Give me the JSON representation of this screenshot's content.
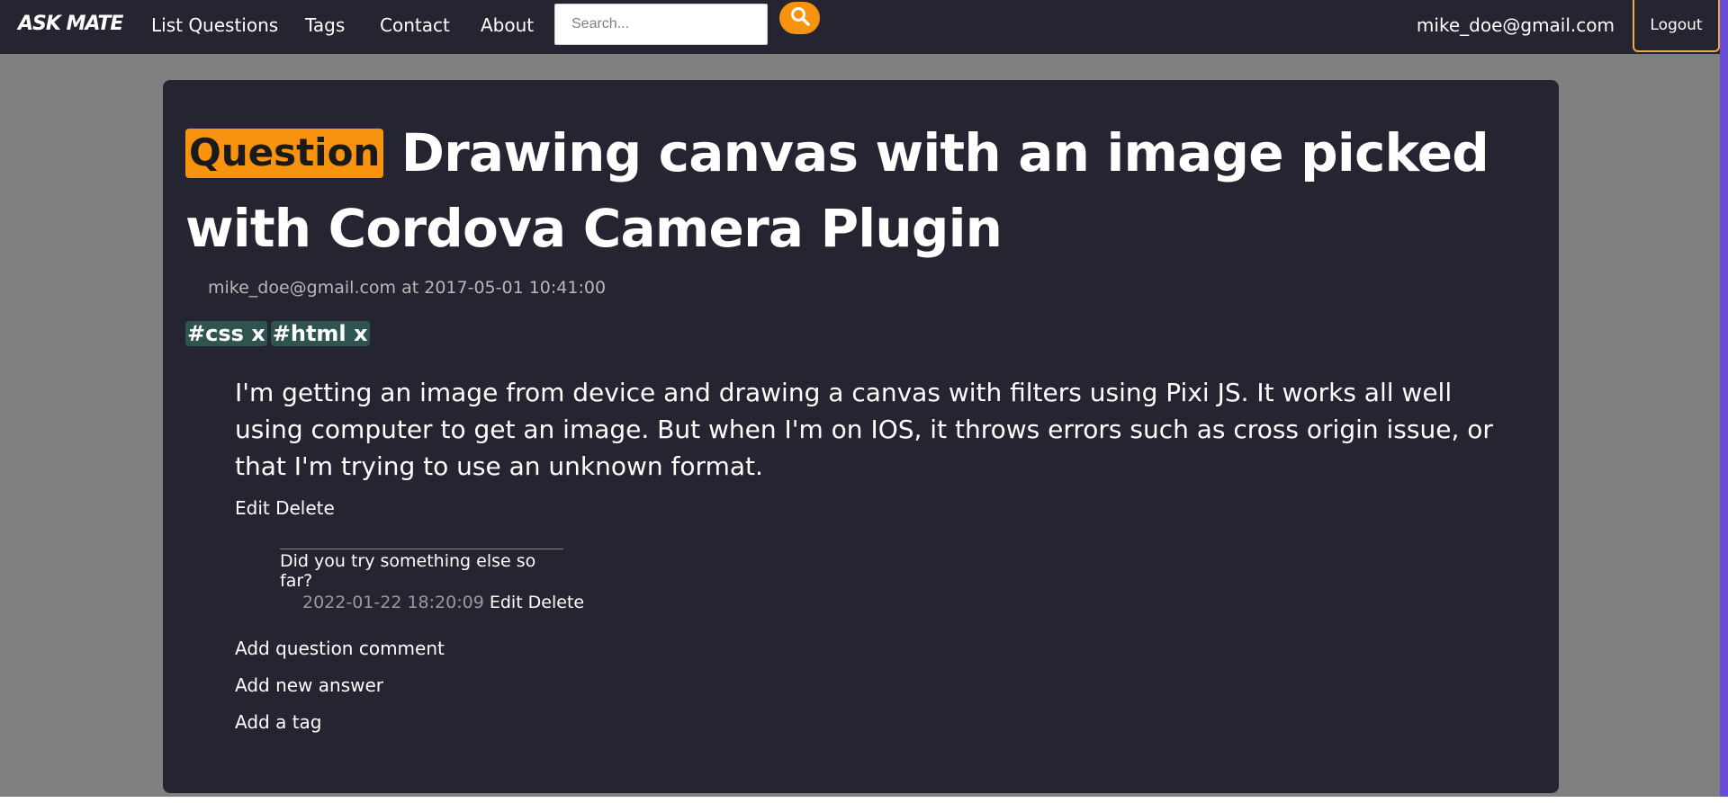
{
  "header": {
    "brand": "ASK MATE",
    "nav": [
      "List Questions",
      "Tags",
      "Contact",
      "About"
    ],
    "search_placeholder": "Search...",
    "user_email": "mike_doe@gmail.com",
    "logout_label": "Logout"
  },
  "question": {
    "badge": "Question",
    "title": "Drawing canvas with an image picked with Cordova Camera Plugin",
    "meta": "mike_doe@gmail.com at 2017-05-01 10:41:00",
    "tags": [
      "#css x",
      "#html x"
    ],
    "body": "I'm getting an image from device and drawing a canvas with filters using Pixi JS. It works all well using computer to get an image. But when I'm on IOS, it throws errors such as cross origin issue, or that I'm trying to use an unknown format.",
    "actions": "Edit Delete"
  },
  "comment": {
    "text": "Did you try something else so far?",
    "date": "2022-01-22 18:20:09",
    "actions": "Edit Delete"
  },
  "links": {
    "add_comment": "Add question comment",
    "add_answer": "Add new answer",
    "add_tag": "Add a tag"
  },
  "colors": {
    "navbar": "#242530",
    "accent": "#f7930e",
    "tag_bg": "#2f5450",
    "page_bg": "#808080"
  },
  "icons": [
    "search-icon"
  ]
}
